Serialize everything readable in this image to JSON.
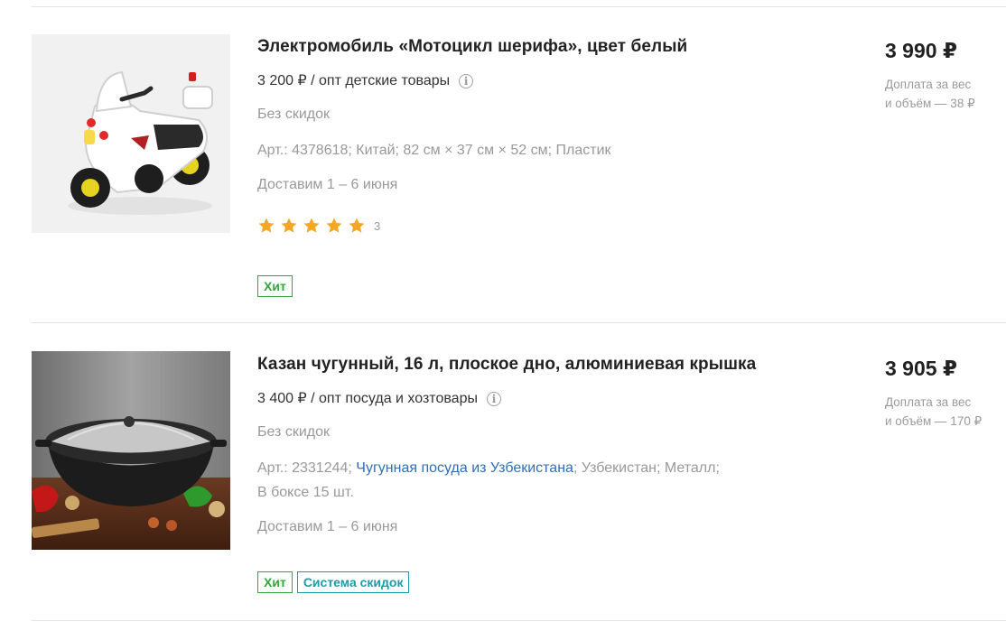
{
  "products": [
    {
      "title": "Электромобиль «Мотоцикл шерифа», цвет белый",
      "wholesale": "3 200 ₽ / опт детские товары",
      "discount": "Без скидок",
      "specs_text": "Арт.: 4378618; Китай; 82 см × 37 см × 52 см; Пластик",
      "delivery": "Доставим 1 – 6 июня",
      "rating_value": 5,
      "rating_count": "3",
      "badges": [
        "Хит"
      ],
      "price": "3 990 ₽",
      "surcharge": "Доплата за вес\nи объём — 38 ₽",
      "image_icon": "white-police-motorcycle"
    },
    {
      "title": "Казан чугунный, 16 л, плоское дно, алюминиевая крышка",
      "wholesale": "3 400 ₽ / опт посуда и хозтовары",
      "discount": "Без скидок",
      "specs_prefix": "Арт.: 2331244; ",
      "specs_link": "Чугунная посуда из Узбекистана",
      "specs_suffix": "; Узбекистан; Металл;",
      "specs_line2": "В боксе 15 шт.",
      "delivery": "Доставим 1 – 6 июня",
      "badges": [
        "Хит",
        "Система скидок"
      ],
      "price": "3 905 ₽",
      "surcharge": "Доплата за вес\nи объём — 170 ₽",
      "image_icon": "cast-iron-kazan"
    }
  ],
  "colors": {
    "badge_hit": "#2eaa3a",
    "badge_discount": "#1d9ba8",
    "star": "#f5a623",
    "link": "#2f6fb2"
  }
}
